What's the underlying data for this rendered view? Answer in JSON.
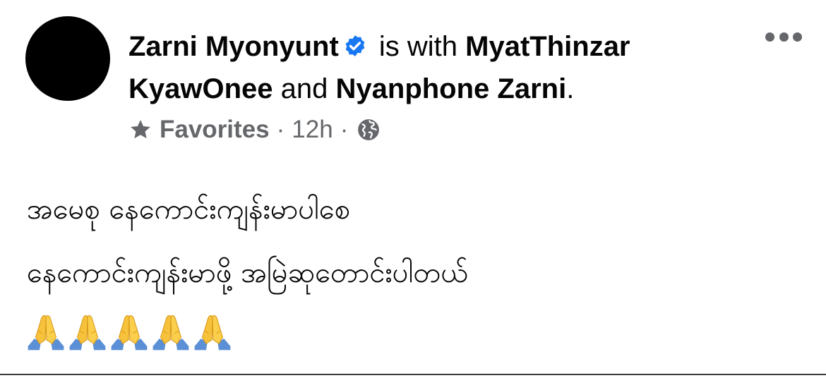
{
  "post": {
    "author": "Zarni Myonyunt",
    "with_text": " is with ",
    "tag1": "MyatThinzar KyawOnee",
    "and_text": " and ",
    "tag2": "Nyanphone Zarni",
    "period": ".",
    "audience_label": "Favorites",
    "separator": "·",
    "time": "12h",
    "line1": "အမေစု နေကောင်းကျန်းမာပါစေ",
    "line2": "နေကောင်းကျန်းမာဖို့ အမြဲဆုတောင်းပါတယ်",
    "emoji_count": 5
  },
  "icons": {
    "verified": "verified-badge-icon",
    "audience": "star-icon",
    "privacy": "globe-icon",
    "more": "more-options-icon",
    "emoji": "folded-hands-emoji"
  },
  "colors": {
    "text": "#050505",
    "secondary": "#65676b",
    "verified_blue": "#1877f2",
    "avatar": "#000000"
  }
}
